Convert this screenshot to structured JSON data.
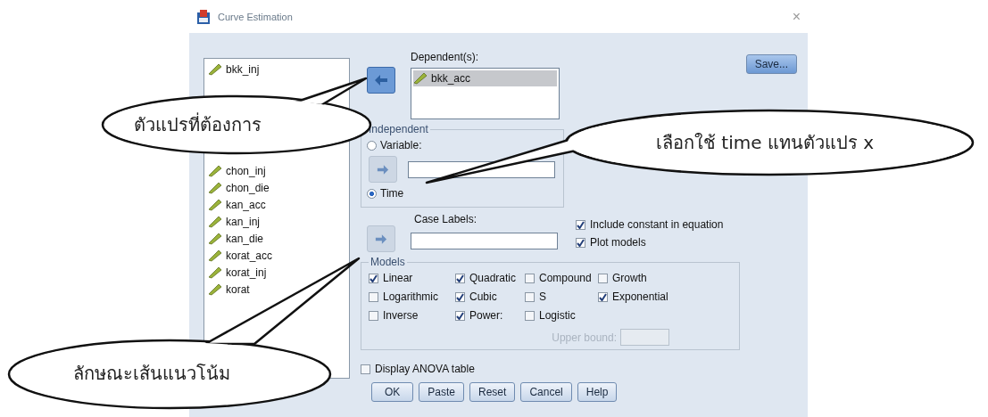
{
  "window": {
    "title": "Curve Estimation",
    "close": "×"
  },
  "variables": [
    {
      "kind": "variable",
      "label": "bkk_inj"
    },
    {
      "kind": "covered"
    },
    {
      "kind": "covered"
    },
    {
      "kind": "covered"
    },
    {
      "kind": "covered"
    },
    {
      "kind": "covered"
    },
    {
      "kind": "variable",
      "label": "chon_inj"
    },
    {
      "kind": "variable",
      "label": "chon_die"
    },
    {
      "kind": "variable",
      "label": "kan_acc"
    },
    {
      "kind": "variable",
      "label": "kan_inj"
    },
    {
      "kind": "variable",
      "label": "kan_die"
    },
    {
      "kind": "variable",
      "label": "korat_acc"
    },
    {
      "kind": "variable",
      "label": "korat_inj"
    },
    {
      "kind": "variable",
      "label": "korat"
    }
  ],
  "dependents": {
    "label": "Dependent(s):",
    "items": [
      "bkk_acc"
    ]
  },
  "save_button": "Save...",
  "independent": {
    "title": "Independent",
    "options": [
      {
        "label": "Variable:",
        "selected": false
      },
      {
        "label": "Time",
        "selected": true
      }
    ]
  },
  "case_labels": {
    "label": "Case Labels:"
  },
  "options": [
    {
      "label": "Include constant in equation",
      "checked": true
    },
    {
      "label": "Plot models",
      "checked": true
    }
  ],
  "models": {
    "title": "Models",
    "items": [
      {
        "label": "Linear",
        "checked": true
      },
      {
        "label": "Quadratic",
        "checked": true
      },
      {
        "label": "Compound",
        "checked": false
      },
      {
        "label": "Growth",
        "checked": false
      },
      {
        "label": "Logarithmic",
        "checked": false
      },
      {
        "label": "Cubic",
        "checked": true
      },
      {
        "label": "S",
        "checked": false
      },
      {
        "label": "Exponential",
        "checked": true
      },
      {
        "label": "Inverse",
        "checked": false
      },
      {
        "label": "Power:",
        "checked": true
      },
      {
        "label": "Logistic",
        "checked": false
      }
    ],
    "upper_bound": {
      "label": "Upper bound:",
      "disabled": true
    }
  },
  "anova": {
    "label": "Display ANOVA table",
    "checked": false
  },
  "buttons": [
    "OK",
    "Paste",
    "Reset",
    "Cancel",
    "Help"
  ],
  "callouts": [
    "ตัวแปรที่ต้องการ",
    "เลือกใช้ time แทนตัวแปร x",
    "ลักษณะเส้นแนวโน้ม"
  ]
}
